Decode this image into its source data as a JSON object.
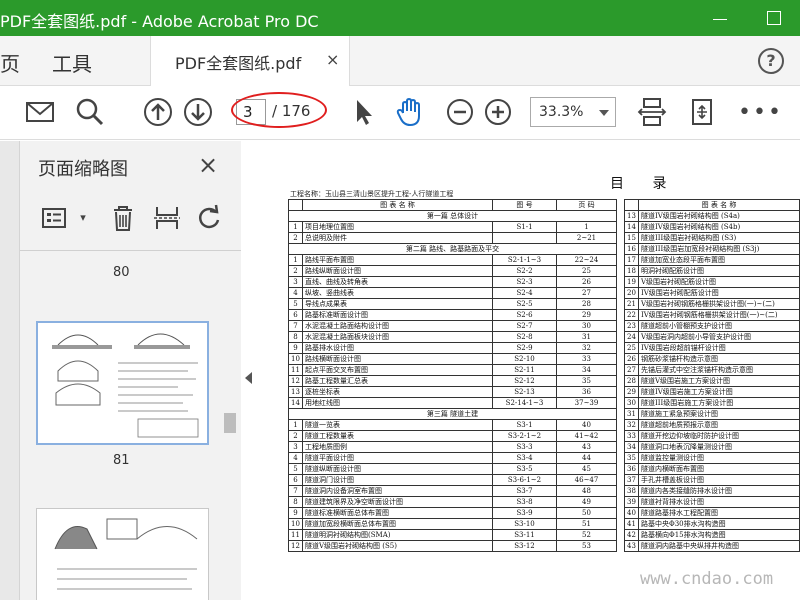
{
  "window": {
    "title": "PDF全套图纸.pdf - Adobe Acrobat Pro DC",
    "colors": {
      "titlebar": "#2b9a2b",
      "annotation": "#e01e1e"
    }
  },
  "menu": {
    "items": [
      "页",
      "工具"
    ],
    "tab_label": "PDF全套图纸.pdf",
    "tab_close": "×",
    "help": "?"
  },
  "toolbar": {
    "page_current": "3",
    "page_total": "/ 176",
    "zoom": "33.3%",
    "more": "•••"
  },
  "panel": {
    "title": "页面缩略图",
    "close": "×",
    "thumb_labels": [
      "80",
      "81"
    ]
  },
  "document": {
    "heading": "目 录",
    "project": "工程名称：玉山县三清山景区提升工程-人行隧道工程",
    "left_table": {
      "headers": [
        "图 表 名 称",
        "图 号",
        "页 码"
      ],
      "rows": [
        {
          "section": "第一篇  总体设计"
        },
        {
          "n": "1",
          "name": "项目地理位置图",
          "code": "S1-1",
          "page": "1"
        },
        {
          "n": "2",
          "name": "总说明及附件",
          "code": "",
          "page": "2~21"
        },
        {
          "section": "第二篇  路线、路基路面及平交"
        },
        {
          "n": "1",
          "name": "路线平面布置图",
          "code": "S2-1-1~3",
          "page": "22~24"
        },
        {
          "n": "2",
          "name": "路线纵断面设计图",
          "code": "S2-2",
          "page": "25"
        },
        {
          "n": "3",
          "name": "直线、曲线及转角表",
          "code": "S2-3",
          "page": "26"
        },
        {
          "n": "4",
          "name": "纵坡、竖曲线表",
          "code": "S2-4",
          "page": "27"
        },
        {
          "n": "5",
          "name": "导线点成果表",
          "code": "S2-5",
          "page": "28"
        },
        {
          "n": "6",
          "name": "路基标准断面设计图",
          "code": "S2-6",
          "page": "29"
        },
        {
          "n": "7",
          "name": "水泥混凝土路面结构设计图",
          "code": "S2-7",
          "page": "30"
        },
        {
          "n": "8",
          "name": "水泥混凝土路面板块设计图",
          "code": "S2-8",
          "page": "31"
        },
        {
          "n": "9",
          "name": "路基排水设计图",
          "code": "S2-9",
          "page": "32"
        },
        {
          "n": "10",
          "name": "路线横断面设计图",
          "code": "S2-10",
          "page": "33"
        },
        {
          "n": "11",
          "name": "起点平面交叉布置图",
          "code": "S2-11",
          "page": "34"
        },
        {
          "n": "12",
          "name": "路基工程数量汇总表",
          "code": "S2-12",
          "page": "35"
        },
        {
          "n": "13",
          "name": "逐桩坐标表",
          "code": "S2-13",
          "page": "36"
        },
        {
          "n": "14",
          "name": "用地红线图",
          "code": "S2-14-1~3",
          "page": "37~39"
        },
        {
          "section": "第三篇  隧道土建"
        },
        {
          "n": "1",
          "name": "隧道一览表",
          "code": "S3-1",
          "page": "40"
        },
        {
          "n": "2",
          "name": "隧道工程数量表",
          "code": "S3-2-1~2",
          "page": "41~42"
        },
        {
          "n": "3",
          "name": "工程地质图例",
          "code": "S3-3",
          "page": "43"
        },
        {
          "n": "4",
          "name": "隧道平面设计图",
          "code": "S3-4",
          "page": "44"
        },
        {
          "n": "5",
          "name": "隧道纵断面设计图",
          "code": "S3-5",
          "page": "45"
        },
        {
          "n": "6",
          "name": "隧道洞门设计图",
          "code": "S3-6-1~2",
          "page": "46~47"
        },
        {
          "n": "7",
          "name": "隧道洞内设备洞室布置图",
          "code": "S3-7",
          "page": "48"
        },
        {
          "n": "8",
          "name": "隧道建筑限界及净空断面设计图",
          "code": "S3-8",
          "page": "49"
        },
        {
          "n": "9",
          "name": "隧道标准横断面总体布置图",
          "code": "S3-9",
          "page": "50"
        },
        {
          "n": "10",
          "name": "隧道加宽段横断面总体布置图",
          "code": "S3-10",
          "page": "51"
        },
        {
          "n": "11",
          "name": "隧道明洞衬砌结构图(SMA)",
          "code": "S3-11",
          "page": "52"
        },
        {
          "n": "12",
          "name": "隧道V级围岩衬砌结构图 (S5)",
          "code": "S3-12",
          "page": "53"
        }
      ]
    },
    "right_table": {
      "headers": [
        "图 表 名 称"
      ],
      "rows": [
        {
          "n": "13",
          "name": "隧道IV级围岩衬砌结构图 (S4a)"
        },
        {
          "n": "14",
          "name": "隧道IV级围岩衬砌结构图 (S4b)"
        },
        {
          "n": "15",
          "name": "隧道III级围岩衬砌结构图 (S3)"
        },
        {
          "n": "16",
          "name": "隧道III级围岩加宽段衬砌结构图 (S3j)"
        },
        {
          "n": "17",
          "name": "隧道加宽业态段平面布置图"
        },
        {
          "n": "18",
          "name": "明洞衬砌配筋设计图"
        },
        {
          "n": "19",
          "name": "V级围岩衬砌配筋设计图"
        },
        {
          "n": "20",
          "name": "IV级围岩衬砌配筋设计图"
        },
        {
          "n": "21",
          "name": "V级围岩衬砌钢筋格栅拱架设计图(一)~(二)"
        },
        {
          "n": "22",
          "name": "IV级围岩衬砌钢筋格栅拱架设计图(一)~(二)"
        },
        {
          "n": "23",
          "name": "隧道超前小管棚预支护设计图"
        },
        {
          "n": "24",
          "name": "V级围岩洞内超前小导管支护设计图"
        },
        {
          "n": "25",
          "name": "IV级围岩段超前锚杆设计图"
        },
        {
          "n": "26",
          "name": "钢筋砂浆锚杆构造示意图"
        },
        {
          "n": "27",
          "name": "先锚后灌式中空注浆锚杆构造示意图"
        },
        {
          "n": "28",
          "name": "隧道V级围岩施工方案设计图"
        },
        {
          "n": "29",
          "name": "隧道IV级围岩施工方案设计图"
        },
        {
          "n": "30",
          "name": "隧道III级围岩施工方案设计图"
        },
        {
          "n": "31",
          "name": "隧道施工紧急预案设计图"
        },
        {
          "n": "32",
          "name": "隧道超前地质预报示意图"
        },
        {
          "n": "33",
          "name": "隧道开挖边仰坡临时防护设计图"
        },
        {
          "n": "34",
          "name": "隧道洞口地表沉降量测设计图"
        },
        {
          "n": "35",
          "name": "隧道监控量测设计图"
        },
        {
          "n": "36",
          "name": "隧道内横断面布置图"
        },
        {
          "n": "37",
          "name": "手孔井槽盖板设计图"
        },
        {
          "n": "38",
          "name": "隧道内各类接缝防排水设计图"
        },
        {
          "n": "39",
          "name": "隧道衬背排水设计图"
        },
        {
          "n": "40",
          "name": "隧道路基排水工程配置图"
        },
        {
          "n": "41",
          "name": "路基中央Φ30排水沟构造图"
        },
        {
          "n": "42",
          "name": "路基横向Φ15排水沟构造图"
        },
        {
          "n": "43",
          "name": "隧道洞内路基中央纵排井构造图"
        }
      ]
    }
  },
  "watermark": "www.cndao.com"
}
